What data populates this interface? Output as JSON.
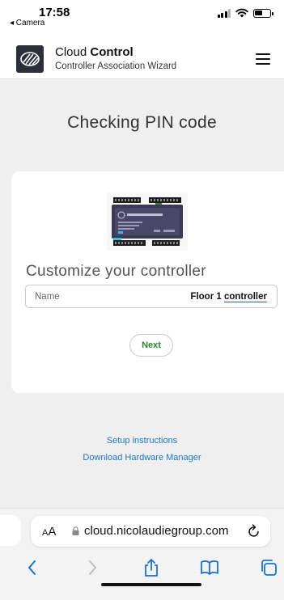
{
  "status_bar": {
    "time": "17:58",
    "back_label": "◂ Camera",
    "icons": [
      "signal-icon",
      "wifi-icon",
      "battery-icon"
    ]
  },
  "header": {
    "brand_prefix": "Cloud ",
    "brand_bold": "Control",
    "subtitle": "Controller Association Wizard",
    "menu_icon": "hamburger-menu-icon"
  },
  "main": {
    "title": "Checking PIN code",
    "card": {
      "device_image": "controller-device-image",
      "section_title": "Customize your controller",
      "name_field": {
        "label": "Name",
        "value_prefix": "Floor 1 ",
        "value_underlined": "controller"
      },
      "next_label": "Next"
    },
    "links": {
      "setup": "Setup instructions",
      "download": "Download Hardware Manager"
    }
  },
  "browser": {
    "aa_small": "A",
    "aa_large": "A",
    "url": "cloud.nicolaudiegroup.com",
    "toolbar": [
      "back-icon",
      "forward-icon",
      "share-icon",
      "bookmarks-icon",
      "tabs-icon"
    ]
  },
  "colors": {
    "page_bg": "#efefef",
    "link": "#1d77c7",
    "next_text": "#1e8a2a",
    "toolbar_blue": "#1a6fe0",
    "logo_bg": "#2c2e38"
  }
}
